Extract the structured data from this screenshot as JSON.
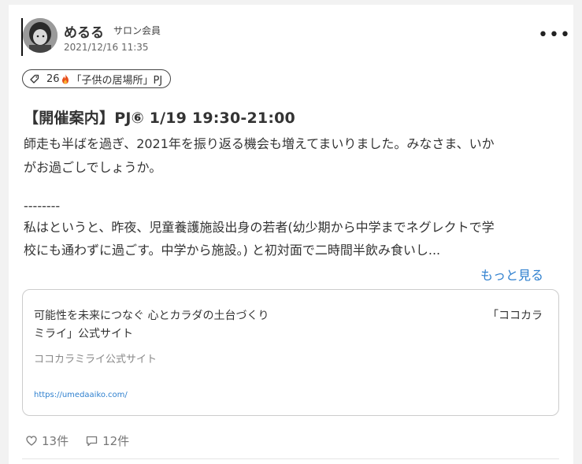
{
  "post": {
    "author": "めるる",
    "role": "サロン会員",
    "date": "2021/12/16 11:35",
    "tag_count": "26",
    "tag_name": "「子供の居場所」PJ",
    "title": "【開催案内】PJ⑥ 1/19 19:30-21:00",
    "body_line1": "師走も半ばを過ぎ、2021年を振り返る機会も増えてまいりました。みなさま、いか",
    "body_line2": "がお過ごしでしょうか。",
    "body_line3": "--------",
    "body_line4": "私はというと、昨夜、児童養護施設出身の若者(幼少期から中学までネグレクトで学",
    "body_line5": "校にも通わずに過ごす。中学から施設。) と初対面で二時間半飲み食いし...",
    "more_label": "もっと見る"
  },
  "link_card": {
    "title_left": "可能性を未来につなぐ 心とカラダの土台づくり",
    "title_right": "「ココカラ",
    "title_line2": "ミライ」公式サイト",
    "site_name": "ココカラミライ公式サイト",
    "url": "https://umedaaiko.com/"
  },
  "actions": {
    "likes": "13件",
    "comments": "12件"
  },
  "icons": {
    "tag": "tag-icon",
    "flame": "flame-icon",
    "like": "heart-icon",
    "comment": "comment-icon",
    "more": "more-icon"
  },
  "colors": {
    "link": "#2f80cf",
    "flame": "#e8501c"
  }
}
